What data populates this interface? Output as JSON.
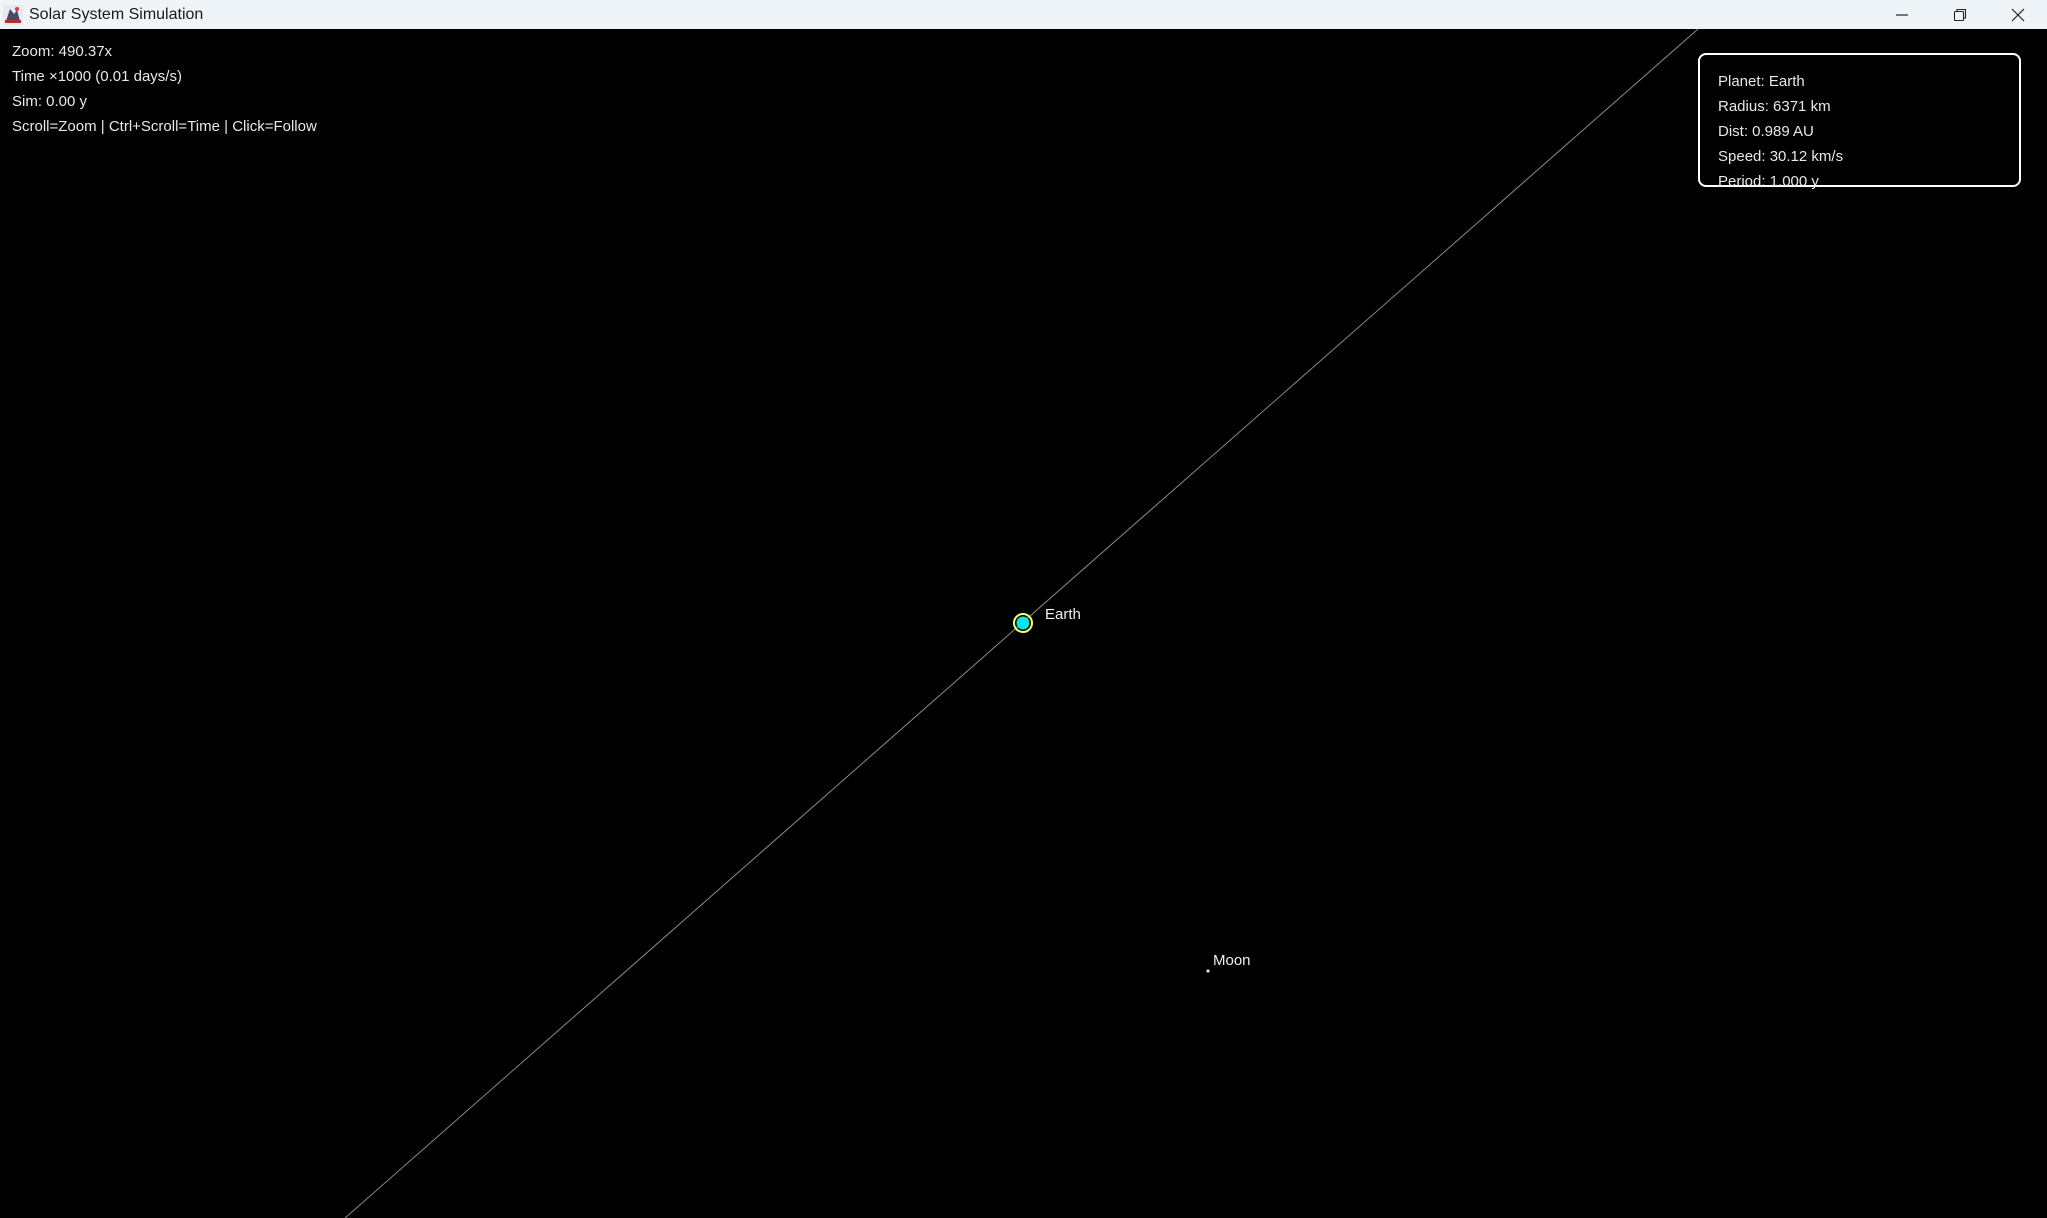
{
  "window": {
    "title": "Solar System Simulation",
    "app_icon": "java-icon",
    "controls": [
      "minimize-icon",
      "restore-icon",
      "close-icon"
    ]
  },
  "hud": {
    "zoom": "Zoom: 490.37x",
    "time": "Time ×1000 (0.01 days/s)",
    "sim": "Sim: 0.00 y",
    "help": "Scroll=Zoom | Ctrl+Scroll=Time | Click=Follow"
  },
  "info_panel": {
    "planet": "Planet: Earth",
    "radius": "Radius: 6371 km",
    "dist": "Dist: 0.989 AU",
    "speed": "Speed: 30.12 km/s",
    "period": "Period: 1.000 y"
  },
  "bodies": {
    "earth": {
      "label": "Earth",
      "color": "#00e5e5",
      "ring_color": "#ffff66"
    },
    "moon": {
      "label": "Moon",
      "color": "#dddddd"
    }
  },
  "colors": {
    "background": "#000000",
    "orbit": "#8a8a8a",
    "text": "#e8e8e8"
  }
}
